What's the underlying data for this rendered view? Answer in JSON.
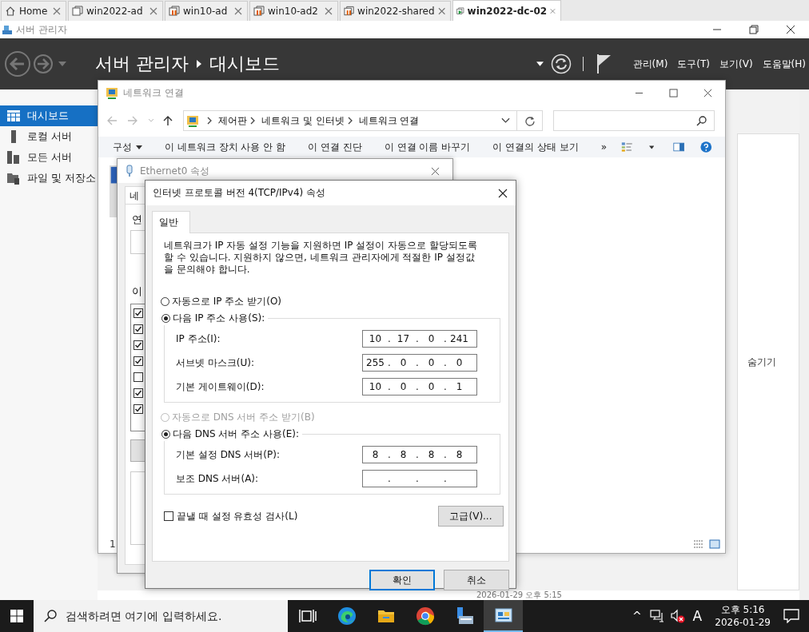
{
  "browser_tabs": [
    {
      "label": "Home",
      "kind": "home",
      "selected": false
    },
    {
      "label": "win2022-ad",
      "kind": "vm",
      "selected": false
    },
    {
      "label": "win10-ad",
      "kind": "vm-paused",
      "selected": false
    },
    {
      "label": "win10-ad2",
      "kind": "vm-paused",
      "selected": false
    },
    {
      "label": "win2022-shared",
      "kind": "vm-paused",
      "selected": false
    },
    {
      "label": "win2022-dc-02",
      "kind": "vm-running",
      "selected": true
    }
  ],
  "app": {
    "title": "서버 관리자",
    "breadcrumb": [
      "서버 관리자",
      "대시보드"
    ],
    "menus": [
      "관리(M)",
      "도구(T)",
      "보기(V)",
      "도움말(H)"
    ]
  },
  "sidebar": [
    {
      "label": "대시보드",
      "kind": "dashboard",
      "selected": true
    },
    {
      "label": "로컬 서버",
      "kind": "server",
      "selected": false
    },
    {
      "label": "모든 서버",
      "kind": "servers",
      "selected": false
    },
    {
      "label": "파일 및 저장소",
      "kind": "storage",
      "selected": false
    }
  ],
  "dashboard": {
    "hide_link": "숨기기",
    "timestamp": "2026-01-29 오후 5:15"
  },
  "network_window": {
    "title": "네트워크 연결",
    "path": [
      "제어판",
      "네트워크 및 인터넷",
      "네트워크 연결"
    ],
    "organize": "구성",
    "commands": [
      "이 네트워크 장치 사용 안 함",
      "이 연결 진단",
      "이 연결 이름 바꾸기",
      "이 연결의 상태 보기"
    ],
    "more": "»",
    "status": "1"
  },
  "ethernet_dialog": {
    "title": "Ethernet0 속성",
    "tab_fragment": "네",
    "connect_fragment": "연",
    "items_fragment": "이",
    "components": [
      {
        "checked": true
      },
      {
        "checked": true
      },
      {
        "checked": true
      },
      {
        "checked": true
      },
      {
        "checked": false
      },
      {
        "checked": true
      },
      {
        "checked": true
      }
    ]
  },
  "ipv4_dialog": {
    "title": "인터넷 프로토콜 버전 4(TCP/IPv4) 속성",
    "tabs": [
      {
        "label": "일반",
        "selected": true
      }
    ],
    "description": "네트워크가 IP 자동 설정 기능을 지원하면 IP 설정이 자동으로 할당되도록 할 수 있습니다. 지원하지 않으면, 네트워크 관리자에게 적절한 IP 설정값을 문의해야 합니다.",
    "octet_separator": ".",
    "ip_auto": {
      "label": "자동으로 IP 주소 받기(O)",
      "selected": false,
      "disabled": false
    },
    "ip_manual": {
      "label": "다음 IP 주소 사용(S):",
      "selected": true,
      "disabled": false
    },
    "ip_fields": [
      {
        "label": "IP 주소(I):",
        "octets": [
          "10",
          "17",
          "0",
          "241"
        ]
      },
      {
        "label": "서브넷 마스크(U):",
        "octets": [
          "255",
          "0",
          "0",
          "0"
        ]
      },
      {
        "label": "기본 게이트웨이(D):",
        "octets": [
          "10",
          "0",
          "0",
          "1"
        ]
      }
    ],
    "dns_auto": {
      "label": "자동으로 DNS 서버 주소 받기(B)",
      "selected": false,
      "disabled": true
    },
    "dns_manual": {
      "label": "다음 DNS 서버 주소 사용(E):",
      "selected": true,
      "disabled": false
    },
    "dns_fields": [
      {
        "label": "기본 설정 DNS 서버(P):",
        "octets": [
          "8",
          "8",
          "8",
          "8"
        ]
      },
      {
        "label": "보조 DNS 서버(A):"
      }
    ],
    "validate": {
      "label": "끝낼 때 설정 유효성 검사(L)",
      "checked": false
    },
    "advanced": "고급(V)...",
    "buttons": [
      {
        "label": "확인",
        "default": true
      },
      {
        "label": "취소",
        "default": false
      }
    ]
  },
  "taskbar": {
    "search_placeholder": "검색하려면 여기에 입력하세요.",
    "apps": [
      {
        "kind": "task-view",
        "selected": false
      },
      {
        "kind": "edge",
        "selected": false
      },
      {
        "kind": "folder",
        "selected": false
      },
      {
        "kind": "chrome",
        "selected": false
      },
      {
        "kind": "server-manager",
        "selected": false
      },
      {
        "kind": "network",
        "selected": true
      }
    ],
    "overflow": "^",
    "ime": "A",
    "time": "오후 5:16",
    "date": "2026-01-29"
  }
}
